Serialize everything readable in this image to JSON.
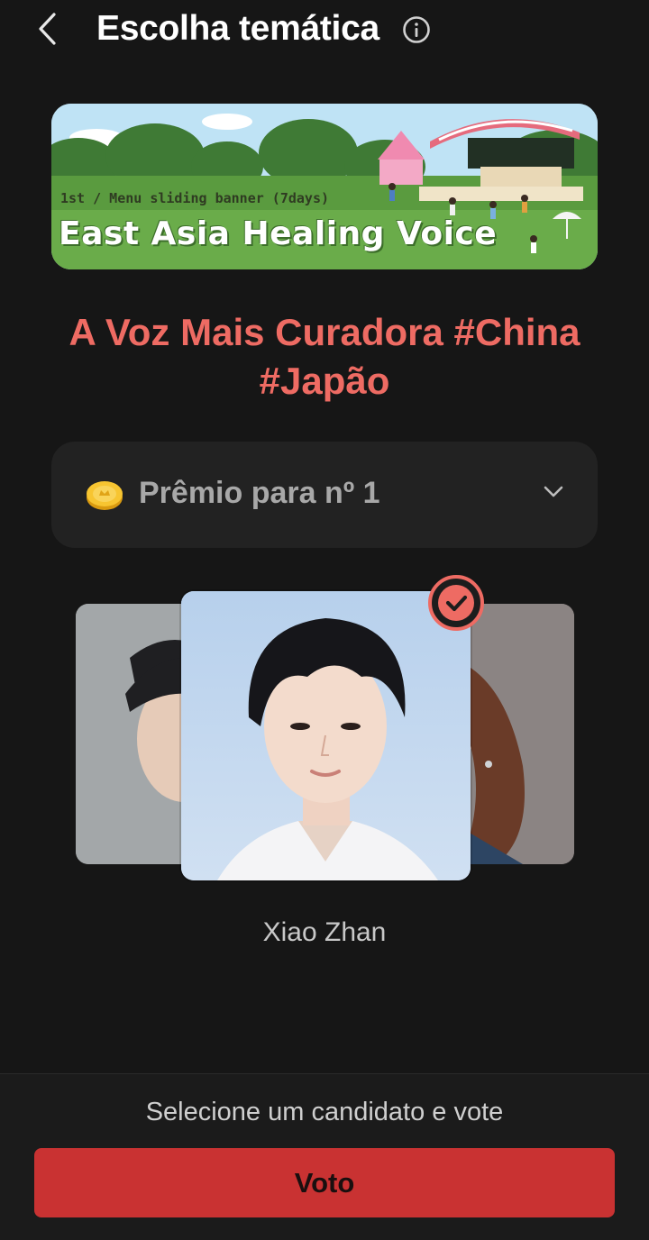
{
  "header": {
    "title": "Escolha temática",
    "back_icon": "chevron-left-icon",
    "info_icon": "info-icon"
  },
  "banner": {
    "subtitle": "1st / Menu sliding banner (7days)",
    "title": "East Asia Healing Voice"
  },
  "topic": {
    "title": "A Voz Mais Curadora #China #Japão",
    "color": "#ee6b63"
  },
  "prize": {
    "label": "Prêmio para nº 1",
    "coin_icon": "coin-icon",
    "expand_icon": "chevron-down-icon"
  },
  "candidates": {
    "selected_name": "Xiao Zhan",
    "selected_icon": "check-icon"
  },
  "footer": {
    "hint": "Selecione um candidato e vote",
    "vote_label": "Voto",
    "vote_color": "#c93232"
  }
}
